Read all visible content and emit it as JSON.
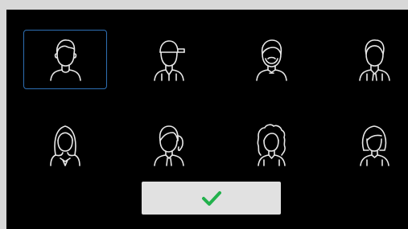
{
  "dialog": {
    "avatars": [
      {
        "id": "male-short-hair",
        "selected": true
      },
      {
        "id": "male-cap",
        "selected": false
      },
      {
        "id": "male-beard",
        "selected": false
      },
      {
        "id": "male-tie",
        "selected": false
      },
      {
        "id": "female-long-hair",
        "selected": false
      },
      {
        "id": "female-ponytail",
        "selected": false
      },
      {
        "id": "female-curly-hair",
        "selected": false
      },
      {
        "id": "female-bob",
        "selected": false
      }
    ],
    "confirm_icon": "checkmark-icon",
    "colors": {
      "background": "#000000",
      "icon_stroke": "#e8e8e8",
      "selection_border": "#2e6fb3",
      "button_bg": "#e1e1e1",
      "checkmark": "#22b14c"
    }
  }
}
